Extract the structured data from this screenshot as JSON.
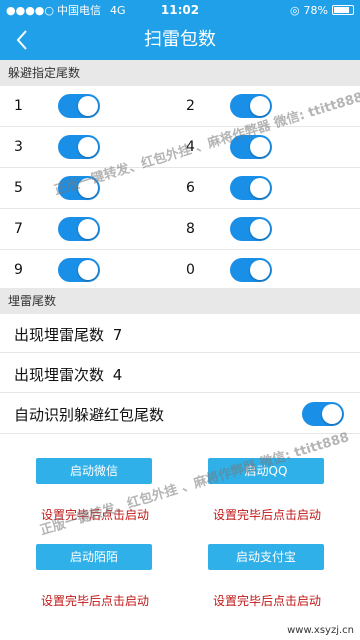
{
  "status_bar": {
    "carrier": "中国电信",
    "network": "4G",
    "time": "11:02",
    "battery": "78%",
    "icons": [
      "signal-icon",
      "alarm-icon",
      "battery-icon"
    ]
  },
  "header": {
    "title": "扫雷包数",
    "back_icon": "back-arrow-icon"
  },
  "avoid_section": {
    "header": "躲避指定尾数",
    "items": [
      {
        "label": "1",
        "on": true
      },
      {
        "label": "2",
        "on": true
      },
      {
        "label": "3",
        "on": true
      },
      {
        "label": "4",
        "on": true
      },
      {
        "label": "5",
        "on": true
      },
      {
        "label": "6",
        "on": true
      },
      {
        "label": "7",
        "on": true
      },
      {
        "label": "8",
        "on": true
      },
      {
        "label": "9",
        "on": true
      },
      {
        "label": "0",
        "on": true
      }
    ]
  },
  "mine_section": {
    "header": "埋雷尾数",
    "tail_count_label": "出现埋雷尾数",
    "tail_count_value": "7",
    "times_label": "出现埋雷次数",
    "times_value": "4",
    "auto_detect_label": "自动识别躲避红包尾数",
    "auto_detect_on": true
  },
  "actions": {
    "wechat_label": "启动微信",
    "qq_label": "启动QQ",
    "momo_label": "启动陌陌",
    "alipay_label": "启动支付宝",
    "hint": "设置完毕后点击启动"
  },
  "watermark": "正版一键转发、红包外挂 、麻将作弊器 微信: ttitt888",
  "site": "www.xsyzj.cn",
  "colors": {
    "accent": "#1fa0e8",
    "toggle": "#1a8fe8",
    "hint": "#c01818",
    "button": "#2fb0e8"
  }
}
